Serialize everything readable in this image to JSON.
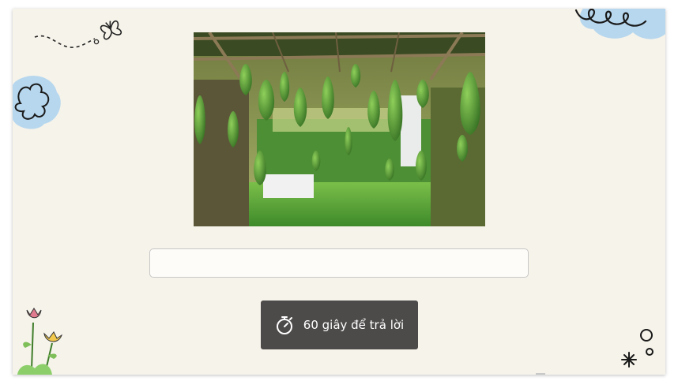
{
  "timer": {
    "label": "60 giây để trả lời",
    "icon": "stopwatch-icon"
  },
  "answer_input": {
    "value": "",
    "placeholder": ""
  },
  "photo": {
    "subject": "gourd trellis"
  },
  "colors": {
    "slide_background": "#f6f3ea",
    "timer_background": "#4d4b4a",
    "cloud_blue": "#b7d7ee",
    "leaf_green": "#3f7d2a"
  }
}
